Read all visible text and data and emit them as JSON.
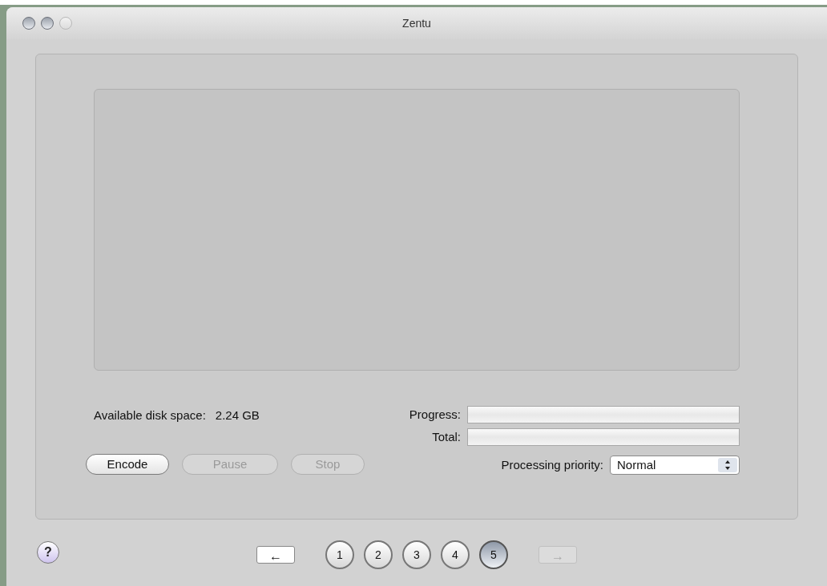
{
  "window": {
    "title": "Zentu",
    "traffic_lights": [
      {
        "disabled": false
      },
      {
        "disabled": false
      },
      {
        "disabled": true
      }
    ]
  },
  "disk_space": {
    "label": "Available disk space:",
    "value": "2.24 GB"
  },
  "meters": [
    {
      "label": "Progress:",
      "level": 0
    },
    {
      "label": "Total:",
      "level": 0
    }
  ],
  "buttons": [
    {
      "label": "Encode",
      "disabled": false
    },
    {
      "label": "Pause",
      "disabled": true
    },
    {
      "label": "Stop",
      "disabled": true
    }
  ],
  "priority": {
    "label": "Processing priority:",
    "value": "Normal"
  },
  "help": {
    "label": "?"
  },
  "nav": {
    "back": {
      "label": "←",
      "disabled": false
    },
    "forward": {
      "label": "→",
      "disabled": true
    },
    "steps": [
      {
        "label": "1",
        "selected": false
      },
      {
        "label": "2",
        "selected": false
      },
      {
        "label": "3",
        "selected": false
      },
      {
        "label": "4",
        "selected": false
      },
      {
        "label": "5",
        "selected": true
      }
    ]
  }
}
